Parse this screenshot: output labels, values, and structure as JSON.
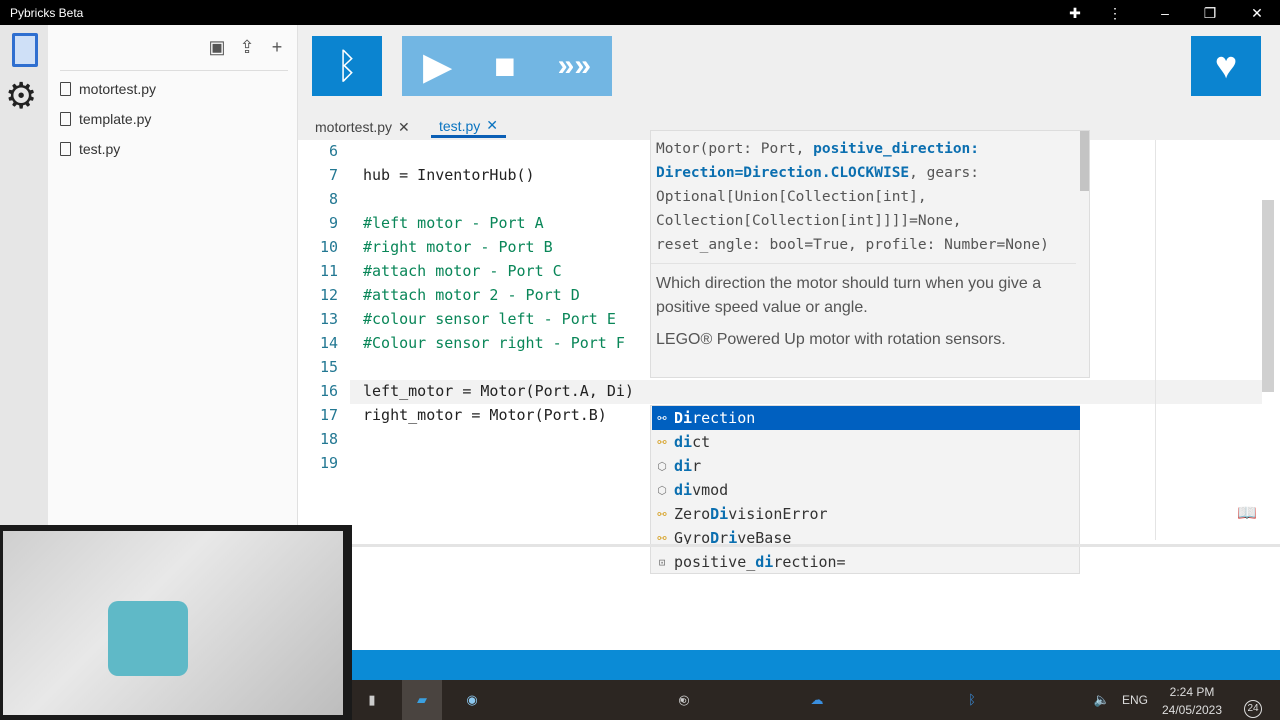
{
  "window": {
    "title": "Pybricks Beta"
  },
  "explorer": {
    "files": [
      "motortest.py",
      "template.py",
      "test.py"
    ]
  },
  "tabs": [
    {
      "label": "motortest.py",
      "active": false
    },
    {
      "label": "test.py",
      "active": true
    }
  ],
  "editor": {
    "lines": [
      {
        "n": "6",
        "code": "",
        "comment": false
      },
      {
        "n": "7",
        "code": "hub = InventorHub()",
        "comment": false
      },
      {
        "n": "8",
        "code": "",
        "comment": false
      },
      {
        "n": "9",
        "code": "#left motor - Port A",
        "comment": true
      },
      {
        "n": "10",
        "code": "#right motor - Port B",
        "comment": true
      },
      {
        "n": "11",
        "code": "#attach motor - Port C",
        "comment": true
      },
      {
        "n": "12",
        "code": "#attach motor 2 - Port D",
        "comment": true
      },
      {
        "n": "13",
        "code": "#colour sensor left - Port E",
        "comment": true
      },
      {
        "n": "14",
        "code": "#Colour sensor right - Port F",
        "comment": true
      },
      {
        "n": "15",
        "code": "",
        "comment": false
      },
      {
        "n": "16",
        "code": "left_motor = Motor(Port.A, Di)",
        "comment": false
      },
      {
        "n": "17",
        "code": "right_motor = Motor(Port.B)",
        "comment": false
      },
      {
        "n": "18",
        "code": "",
        "comment": false
      },
      {
        "n": "19",
        "code": "",
        "comment": false
      }
    ]
  },
  "hover": {
    "sig_pre": "Motor(port: Port, ",
    "sig_active": "positive_direction: Direction=Direction.CLOCKWISE",
    "sig_post": ", gears: Optional[Union[Collection[int], Collection[Collection[int]]]]=None, reset_angle: bool=True, profile: Number=None)",
    "doc1": "Which direction the motor should turn when you give a positive speed value or angle.",
    "doc2": "LEGO® Powered Up motor with rotation sensors."
  },
  "suggestions": [
    {
      "icon": "class",
      "parts": [
        {
          "t": "Di",
          "m": 1
        },
        {
          "t": "rection"
        }
      ],
      "selected": true
    },
    {
      "icon": "class",
      "parts": [
        {
          "t": "di",
          "m": 1
        },
        {
          "t": "ct"
        }
      ]
    },
    {
      "icon": "function",
      "parts": [
        {
          "t": "di",
          "m": 1
        },
        {
          "t": "r"
        }
      ]
    },
    {
      "icon": "function",
      "parts": [
        {
          "t": "di",
          "m": 1
        },
        {
          "t": "vmod"
        }
      ]
    },
    {
      "icon": "class",
      "parts": [
        {
          "t": "Zero"
        },
        {
          "t": "Di",
          "m": 1
        },
        {
          "t": "visionError"
        }
      ]
    },
    {
      "icon": "class",
      "parts": [
        {
          "t": "Gyro"
        },
        {
          "t": "D",
          "m": 1
        },
        {
          "t": "r"
        },
        {
          "t": "i",
          "m": 1
        },
        {
          "t": "veBase"
        }
      ]
    },
    {
      "icon": "variable",
      "parts": [
        {
          "t": "positive_"
        },
        {
          "t": "di",
          "m": 1
        },
        {
          "t": "rection="
        }
      ]
    }
  ],
  "taskbar": {
    "time": "2:24 PM",
    "date": "24/05/2023",
    "lang": "ENG",
    "notifications": "24"
  },
  "colors": {
    "accent": "#0b84d0",
    "selection": "#0060c0",
    "comment": "#098658"
  }
}
